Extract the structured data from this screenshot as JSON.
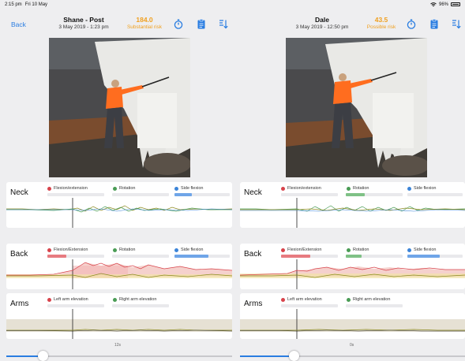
{
  "status": {
    "time": "2:15 pm",
    "date": "Fri 10 May",
    "battery": "96%"
  },
  "nav": {
    "back_label": "Back"
  },
  "colors": {
    "accent": "#2a7de1",
    "risk": "#f0a020",
    "red": "#d8434b",
    "green": "#4a9c55",
    "blue": "#3c84d8",
    "black": "#222222",
    "olive": "#8c8a22"
  },
  "icons": [
    "stopwatch-icon",
    "clipboard-icon",
    "sort-icon"
  ],
  "assessments": [
    {
      "name": "Shane - Post",
      "date": "3 May 2019 - 1:23 pm",
      "score": "184.0",
      "risk": "Substantial risk",
      "photo_alt": "Worker in orange hi-vis vest using a hose on large white machinery",
      "sections": [
        {
          "title": "Neck",
          "legend": [
            "Flexion/extension",
            "Rotation",
            "Side flexion"
          ],
          "fills": [
            0.0,
            0.0,
            0.32
          ]
        },
        {
          "title": "Back",
          "legend": [
            "Flexion/Extension",
            "Rotation",
            "Side flexion"
          ],
          "fills": [
            0.34,
            0.0,
            0.62
          ]
        },
        {
          "title": "Arms",
          "legend": [
            "Left arm elevation",
            "Right arm elevation"
          ],
          "fills": [
            0.0,
            0.0
          ]
        }
      ],
      "timeline_label": "12s",
      "slider_progress": 0.16
    },
    {
      "name": "Dale",
      "date": "3 May 2019 - 12:50 pm",
      "score": "43.5",
      "risk": "Possible risk",
      "photo_alt": "Worker in orange hi-vis vest using a hose on large white machinery",
      "sections": [
        {
          "title": "Neck",
          "legend": [
            "Flexion/extension",
            "Rotation",
            "Side flexion"
          ],
          "fills": [
            0.0,
            0.34,
            0.0
          ]
        },
        {
          "title": "Back",
          "legend": [
            "Flexion/Extension",
            "Rotation",
            "Side flexion"
          ],
          "fills": [
            0.52,
            0.28,
            0.58
          ]
        },
        {
          "title": "Arms",
          "legend": [
            "Left arm elevation",
            "Right arm elevation"
          ],
          "fills": [
            0.0,
            0.0
          ]
        }
      ],
      "timeline_label": "0s",
      "slider_progress": 0.24
    }
  ]
}
